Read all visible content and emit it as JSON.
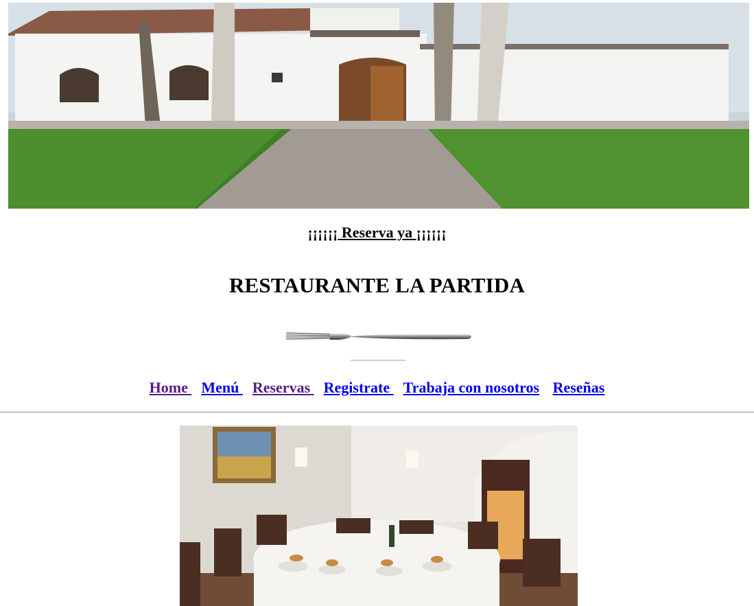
{
  "hero": {
    "image_description": "photo-building"
  },
  "reserva": {
    "prefix": "¡¡¡¡¡¡",
    "label": " Reserva ya ",
    "suffix": "¡¡¡¡¡¡"
  },
  "title": "RESTAURANTE LA PARTIDA",
  "nav": {
    "items": [
      {
        "label": "Home ",
        "state": "visited"
      },
      {
        "label": "Menú ",
        "state": "link"
      },
      {
        "label": "Reservas ",
        "state": "visited"
      },
      {
        "label": "Registrate ",
        "state": "link"
      },
      {
        "label": "Trabaja con nosotros",
        "state": "link"
      },
      {
        "label": "Reseñas",
        "state": "link"
      }
    ]
  },
  "colors": {
    "visited": "#551a8b",
    "link": "#0000ee",
    "rule": "#8c8c8c"
  }
}
